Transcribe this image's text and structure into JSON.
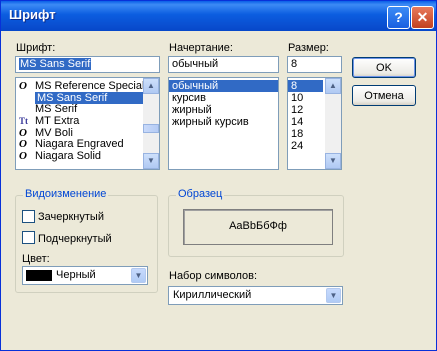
{
  "title": "Шрифт",
  "font": {
    "label": "Шрифт:",
    "value": "MS Sans Serif",
    "items": [
      {
        "name": "MS Reference Specialty",
        "icon": "O"
      },
      {
        "name": "MS Sans Serif",
        "icon": "",
        "selected": true
      },
      {
        "name": "MS Serif",
        "icon": ""
      },
      {
        "name": "MT Extra",
        "icon": "TT"
      },
      {
        "name": "MV Boli",
        "icon": "O"
      },
      {
        "name": "Niagara Engraved",
        "icon": "O"
      },
      {
        "name": "Niagara Solid",
        "icon": "O"
      }
    ]
  },
  "style": {
    "label": "Начертание:",
    "value": "обычный",
    "items": [
      "обычный",
      "курсив",
      "жирный",
      "жирный курсив"
    ]
  },
  "size": {
    "label": "Размер:",
    "value": "8",
    "items": [
      "8",
      "10",
      "12",
      "14",
      "18",
      "24"
    ]
  },
  "buttons": {
    "ok": "OK",
    "cancel": "Отмена"
  },
  "effects": {
    "label": "Видоизменение",
    "strikeout": "Зачеркнутый",
    "underline": "Подчеркнутый",
    "color_label": "Цвет:",
    "color_value": "Черный",
    "swatch": "#000000"
  },
  "sample": {
    "label": "Образец",
    "text": "AaBbБбФф"
  },
  "script": {
    "label": "Набор символов:",
    "value": "Кириллический"
  }
}
